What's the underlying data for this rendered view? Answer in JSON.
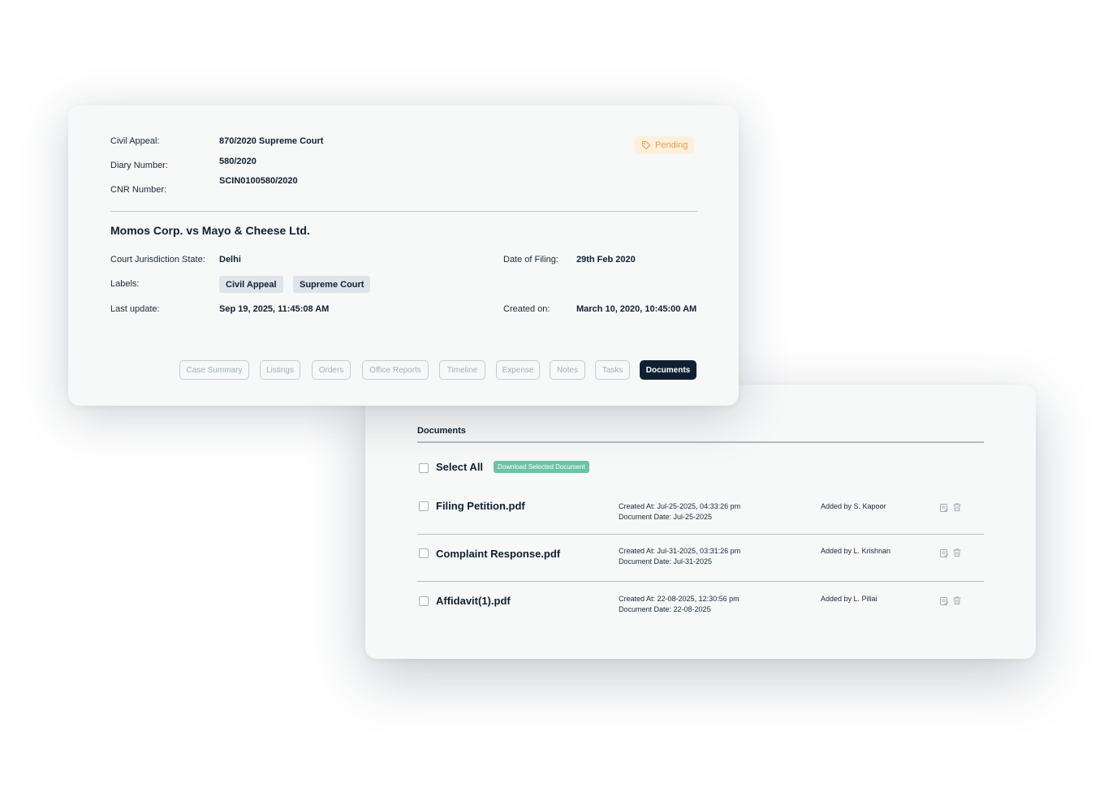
{
  "case": {
    "fields": [
      {
        "label": "Civil Appeal:",
        "value": "870/2020 Supreme Court"
      },
      {
        "label": "Diary Number:",
        "value": "580/2020"
      },
      {
        "label": "CNR Number:",
        "value": "SCIN0100580/2020"
      }
    ],
    "status": "Pending",
    "status_icon": "tag-icon",
    "status_color": "#e3a14a",
    "title": "Momos Corp. vs Mayo & Cheese Ltd.",
    "jurisdiction_label": "Court Jurisdiction State:",
    "jurisdiction_value": "Delhi",
    "date_of_filing_label": "Date of Filing:",
    "date_of_filing_value": "29th Feb 2020",
    "labels_label": "Labels:",
    "labels": [
      "Civil Appeal",
      "Supreme Court"
    ],
    "last_update_label": "Last update:",
    "last_update_value": "Sep 19, 2025, 11:45:08 AM",
    "created_on_label": "Created on:",
    "created_on_value": "March 10, 2020, 10:45:00 AM"
  },
  "tabs": [
    {
      "label": "Case Summary",
      "active": false
    },
    {
      "label": "Listings",
      "active": false
    },
    {
      "label": "Orders",
      "active": false
    },
    {
      "label": "Office Reports",
      "active": false
    },
    {
      "label": "Timeline",
      "active": false
    },
    {
      "label": "Expense",
      "active": false
    },
    {
      "label": "Notes",
      "active": false
    },
    {
      "label": "Tasks",
      "active": false
    },
    {
      "label": "Documents",
      "active": true
    }
  ],
  "documents": {
    "heading": "Documents",
    "select_all": "Select All",
    "download_button": "Download Selected Document",
    "download_color": "#6cc3a7",
    "items": [
      {
        "name": "Filing Petition.pdf",
        "created_at": "Created At: Jul-25-2025, 04:33:26 pm",
        "document_date": "Document Date: Jul-25-2025",
        "added_by": "Added by S. Kapoor"
      },
      {
        "name": "Complaint Response.pdf",
        "created_at": "Created At: Jul-31-2025, 03:31:26 pm",
        "document_date": "Document Date: Jul-31-2025",
        "added_by": "Added by L. Krishnan"
      },
      {
        "name": "Affidavit(1).pdf",
        "created_at": "Created At: 22-08-2025, 12:30:56 pm",
        "document_date": "Document Date: 22-08-2025",
        "added_by": "Added by L. Pillai"
      }
    ],
    "row_icons": [
      "view-document-icon",
      "trash-icon"
    ]
  }
}
